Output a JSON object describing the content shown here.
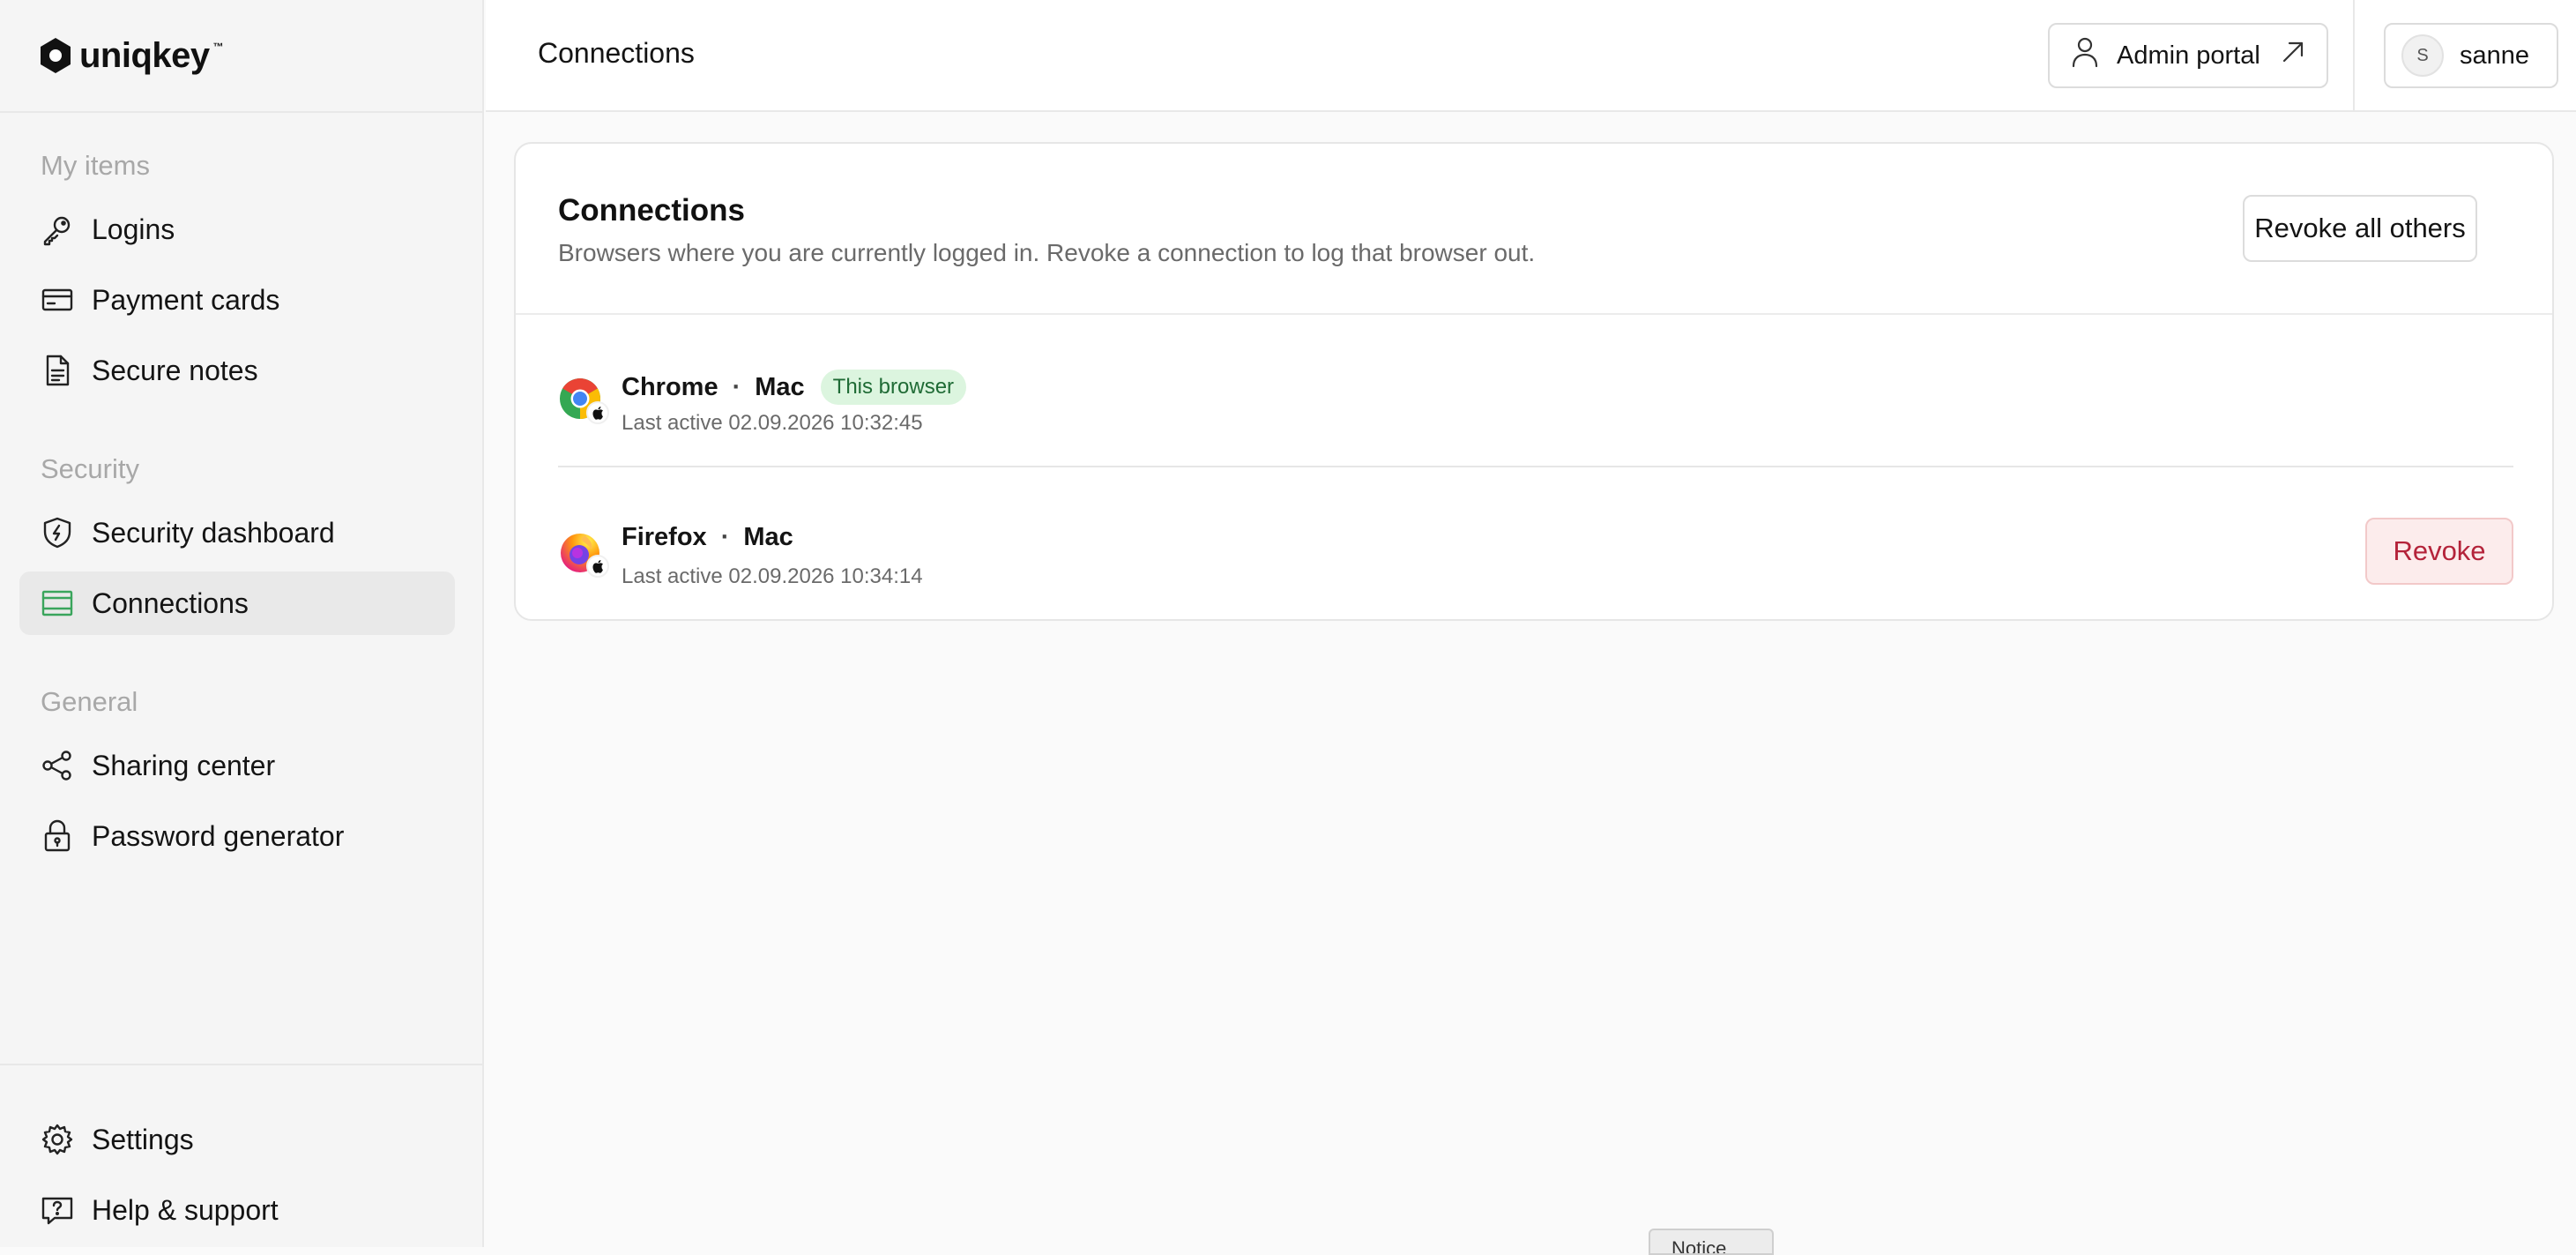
{
  "app": {
    "logo_text": "uniqkey",
    "logo_tm": "™"
  },
  "sidebar": {
    "sections": [
      {
        "label": "My items"
      },
      {
        "label": "Security"
      },
      {
        "label": "General"
      }
    ],
    "items": [
      {
        "label": "Logins",
        "icon": "key-icon"
      },
      {
        "label": "Payment cards",
        "icon": "credit-card-icon"
      },
      {
        "label": "Secure notes",
        "icon": "document-icon"
      },
      {
        "label": "Security dashboard",
        "icon": "shield-icon"
      },
      {
        "label": "Connections",
        "icon": "connections-icon",
        "active": true
      },
      {
        "label": "Sharing center",
        "icon": "share-icon"
      },
      {
        "label": "Password generator",
        "icon": "lock-icon"
      }
    ],
    "footer_items": [
      {
        "label": "Settings",
        "icon": "gear-icon"
      },
      {
        "label": "Help & support",
        "icon": "help-chat-icon"
      }
    ]
  },
  "header": {
    "title": "Connections",
    "admin_portal_label": "Admin portal",
    "user": {
      "initial": "S",
      "name": "sanne"
    }
  },
  "card": {
    "title": "Connections",
    "subtitle": "Browsers where you are currently logged in. Revoke a connection to log that browser out.",
    "revoke_all_label": "Revoke all others",
    "connections": [
      {
        "browser": "Chrome",
        "separator": "·",
        "os": "Mac",
        "badge": "This browser",
        "last_active": "Last active 02.09.2026 10:32:45",
        "icon": "chrome-icon"
      },
      {
        "browser": "Firefox",
        "separator": "·",
        "os": "Mac",
        "last_active": "Last active 02.09.2026 10:34:14",
        "revoke_label": "Revoke",
        "icon": "firefox-icon"
      }
    ]
  },
  "toast": {
    "label": "Notice"
  },
  "colors": {
    "accent_active_icon": "#3aa55c",
    "badge_bg": "#dcf5df",
    "badge_text": "#1f6b35",
    "danger_text": "#b4233a",
    "danger_bg": "#fcecec"
  }
}
